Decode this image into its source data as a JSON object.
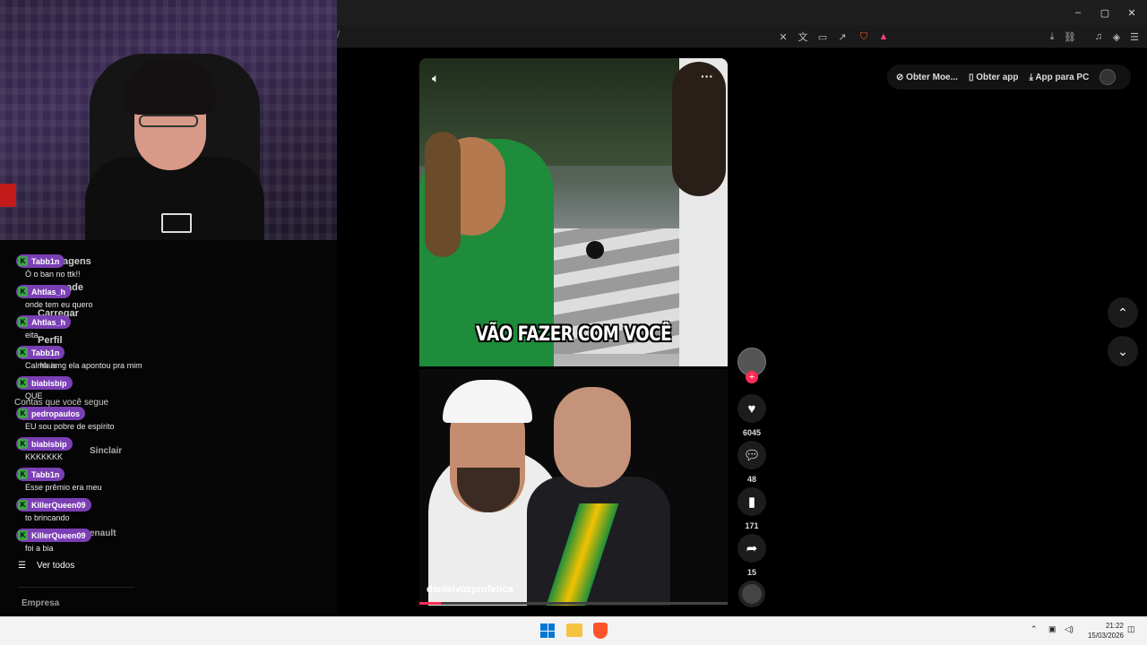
{
  "browser": {
    "url_fragment": "/",
    "window_controls": {
      "minimize": "–",
      "maximize": "▢",
      "close": "✕"
    }
  },
  "topbar": {
    "get_coins": "Obter Moe...",
    "get_app": "Obter app",
    "app_for_pc": "App para PC"
  },
  "sidebar": {
    "nav_behind": [
      "agens",
      "ade",
      "Carregar",
      "Perfil",
      "Mais",
      "Contas que você segue",
      "Sinclair",
      "enault"
    ],
    "see_all": "Ver todos",
    "company": "Empresa"
  },
  "chat": [
    {
      "user": "Tabb1n",
      "message": "Ó o ban no ttk!!"
    },
    {
      "user": "Ahtlas_h",
      "message": "onde tem eu quero"
    },
    {
      "user": "Ahtlas_h",
      "message": "eita"
    },
    {
      "user": "Tabb1n",
      "message": "Calma amg ela apontou pra mim"
    },
    {
      "user": "biabisbip",
      "message": "QUE"
    },
    {
      "user": "pedropaulos",
      "message": "EU sou pobre de espírito"
    },
    {
      "user": "biabisbip",
      "message": "KKKKKKK"
    },
    {
      "user": "Tabb1n",
      "message": "Esse prêmio era meu"
    },
    {
      "user": "KillerQueen09",
      "message": "to brincando"
    },
    {
      "user": "KillerQueen09",
      "message": "foi a bia"
    }
  ],
  "video": {
    "caption": "VÃO FAZER COM VOCÊ",
    "author_handle": "danielvozprofetica",
    "more_label": "···",
    "likes": "6045",
    "comments": "48",
    "saves": "171",
    "shares": "15"
  },
  "taskbar": {
    "time": "21:22",
    "date": "15/03/2026"
  },
  "colors": {
    "chat_name_bg": "#7b3fb5",
    "badge_green": "#3fa34d",
    "follow_red": "#fe2c55"
  }
}
